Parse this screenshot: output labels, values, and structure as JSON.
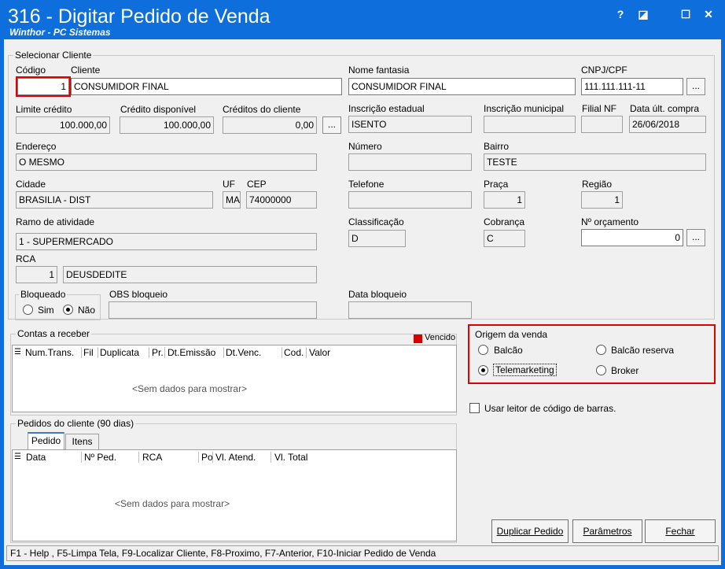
{
  "window": {
    "title": "316 - Digitar Pedido de Venda",
    "subtitle": "Winthor - PC Sistemas",
    "help_label": "?",
    "restore_label": "◪",
    "maximize_label": "☐",
    "close_label": "✕"
  },
  "cliente_group": {
    "title": "Selecionar Cliente",
    "codigo_label": "Código",
    "codigo_value": "1",
    "cliente_label": "Cliente",
    "cliente_value": "CONSUMIDOR FINAL",
    "fantasia_label": "Nome fantasia",
    "fantasia_value": "CONSUMIDOR FINAL",
    "cnpj_label": "CNPJ/CPF",
    "cnpj_value": "111.111.111-11",
    "limite_label": "Limite crédito",
    "limite_value": "100.000,00",
    "disponivel_label": "Crédito disponível",
    "disponivel_value": "100.000,00",
    "creditos_label": "Créditos do cliente",
    "creditos_value": "0,00",
    "insc_estadual_label": "Inscrição estadual",
    "insc_estadual_value": "ISENTO",
    "insc_municipal_label": "Inscrição municipal",
    "insc_municipal_value": "",
    "filial_label": "Filial NF",
    "filial_value": "",
    "data_compra_label": "Data últ. compra",
    "data_compra_value": "26/06/2018",
    "endereco_label": "Endereço",
    "endereco_value": "O MESMO",
    "numero_label": "Número",
    "numero_value": "",
    "bairro_label": "Bairro",
    "bairro_value": "TESTE",
    "cidade_label": "Cidade",
    "cidade_value": "BRASILIA - DIST",
    "uf_label": "UF",
    "uf_value": "MA",
    "cep_label": "CEP",
    "cep_value": "74000000",
    "telefone_label": "Telefone",
    "telefone_value": "",
    "praca_label": "Praça",
    "praca_value": "1",
    "regiao_label": "Região",
    "regiao_value": "1",
    "ramo_label": "Ramo de atividade",
    "ramo_value": "1 - SUPERMERCADO",
    "classificacao_label": "Classificação",
    "classificacao_value": "D",
    "cobranca_label": "Cobrança",
    "cobranca_value": "C",
    "orcamento_label": "Nº orçamento",
    "orcamento_value": "0",
    "rca_label": "RCA",
    "rca_code": "1",
    "rca_name": "DEUSDEDITE",
    "bloqueado_label": "Bloqueado",
    "sim_label": "Sim",
    "nao_label": "Não",
    "obs_label": "OBS bloqueio",
    "obs_value": "",
    "data_bloqueio_label": "Data bloqueio",
    "data_bloqueio_value": "",
    "dots_label": "..."
  },
  "contas": {
    "title": "Contas a receber",
    "legend_vencido": "Vencido",
    "columns": [
      "Num.Trans.",
      "Fil",
      "Duplicata",
      "Pr.",
      "Dt.Emissão",
      "Dt.Venc.",
      "Cod.",
      "Valor"
    ],
    "empty": "<Sem dados para mostrar>"
  },
  "origem": {
    "title": "Origem da venda",
    "balcao": "Balcão",
    "balcao_reserva": "Balcão reserva",
    "telemarketing": "Telemarketing",
    "broker": "Broker",
    "selected": "telemarketing"
  },
  "barcode_label": "Usar leitor de código de barras.",
  "pedidos": {
    "title": "Pedidos do cliente (90 dias)",
    "tab_pedido": "Pedido",
    "tab_itens": "Itens",
    "columns": [
      "Data",
      "Nº Ped.",
      "RCA",
      "Po",
      "Vl. Atend.",
      "Vl. Total"
    ],
    "empty": "<Sem dados para mostrar>"
  },
  "buttons": {
    "duplicar": "Duplicar Pedido",
    "parametros": "Parâmetros",
    "fechar": "Fechar"
  },
  "status": "F1 - Help , F5-Limpa Tela, F9-Localizar Cliente, F8-Proximo, F7-Anterior, F10-Iniciar Pedido de Venda",
  "colors": {
    "title_bar": "#0e6fdc",
    "highlight": "#e00000"
  }
}
